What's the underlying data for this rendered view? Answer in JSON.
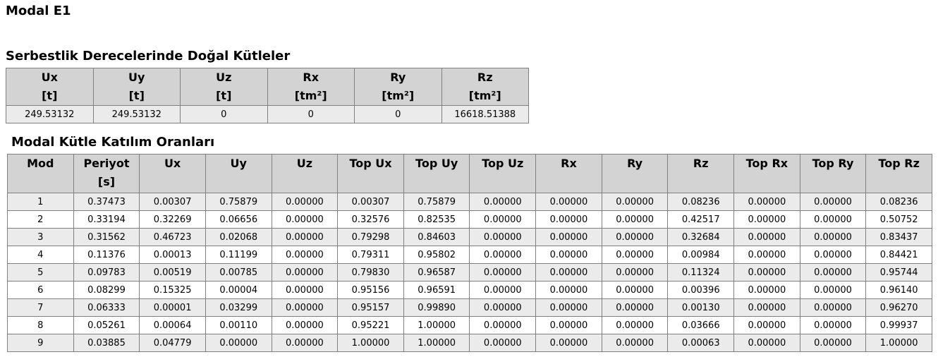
{
  "page_title": "Modal E1",
  "mass_section": {
    "title": "Serbestlik Derecelerinde Doğal Kütleler",
    "headers": [
      {
        "name": "Ux",
        "unit": "[t]"
      },
      {
        "name": "Uy",
        "unit": "[t]"
      },
      {
        "name": "Uz",
        "unit": "[t]"
      },
      {
        "name": "Rx",
        "unit": "[tm²]"
      },
      {
        "name": "Ry",
        "unit": "[tm²]"
      },
      {
        "name": "Rz",
        "unit": "[tm²]"
      }
    ],
    "row": [
      "249.53132",
      "249.53132",
      "0",
      "0",
      "0",
      "16618.51388"
    ]
  },
  "modal_section": {
    "title": "Modal Kütle Katılım Oranları",
    "headers": [
      {
        "name": "Mod",
        "unit": ""
      },
      {
        "name": "Periyot",
        "unit": "[s]"
      },
      {
        "name": "Ux",
        "unit": ""
      },
      {
        "name": "Uy",
        "unit": ""
      },
      {
        "name": "Uz",
        "unit": ""
      },
      {
        "name": "Top Ux",
        "unit": ""
      },
      {
        "name": "Top Uy",
        "unit": ""
      },
      {
        "name": "Top Uz",
        "unit": ""
      },
      {
        "name": "Rx",
        "unit": ""
      },
      {
        "name": "Ry",
        "unit": ""
      },
      {
        "name": "Rz",
        "unit": ""
      },
      {
        "name": "Top Rx",
        "unit": ""
      },
      {
        "name": "Top Ry",
        "unit": ""
      },
      {
        "name": "Top Rz",
        "unit": ""
      }
    ],
    "rows": [
      [
        "1",
        "0.37473",
        "0.00307",
        "0.75879",
        "0.00000",
        "0.00307",
        "0.75879",
        "0.00000",
        "0.00000",
        "0.00000",
        "0.08236",
        "0.00000",
        "0.00000",
        "0.08236"
      ],
      [
        "2",
        "0.33194",
        "0.32269",
        "0.06656",
        "0.00000",
        "0.32576",
        "0.82535",
        "0.00000",
        "0.00000",
        "0.00000",
        "0.42517",
        "0.00000",
        "0.00000",
        "0.50752"
      ],
      [
        "3",
        "0.31562",
        "0.46723",
        "0.02068",
        "0.00000",
        "0.79298",
        "0.84603",
        "0.00000",
        "0.00000",
        "0.00000",
        "0.32684",
        "0.00000",
        "0.00000",
        "0.83437"
      ],
      [
        "4",
        "0.11376",
        "0.00013",
        "0.11199",
        "0.00000",
        "0.79311",
        "0.95802",
        "0.00000",
        "0.00000",
        "0.00000",
        "0.00984",
        "0.00000",
        "0.00000",
        "0.84421"
      ],
      [
        "5",
        "0.09783",
        "0.00519",
        "0.00785",
        "0.00000",
        "0.79830",
        "0.96587",
        "0.00000",
        "0.00000",
        "0.00000",
        "0.11324",
        "0.00000",
        "0.00000",
        "0.95744"
      ],
      [
        "6",
        "0.08299",
        "0.15325",
        "0.00004",
        "0.00000",
        "0.95156",
        "0.96591",
        "0.00000",
        "0.00000",
        "0.00000",
        "0.00396",
        "0.00000",
        "0.00000",
        "0.96140"
      ],
      [
        "7",
        "0.06333",
        "0.00001",
        "0.03299",
        "0.00000",
        "0.95157",
        "0.99890",
        "0.00000",
        "0.00000",
        "0.00000",
        "0.00130",
        "0.00000",
        "0.00000",
        "0.96270"
      ],
      [
        "8",
        "0.05261",
        "0.00064",
        "0.00110",
        "0.00000",
        "0.95221",
        "1.00000",
        "0.00000",
        "0.00000",
        "0.00000",
        "0.03666",
        "0.00000",
        "0.00000",
        "0.99937"
      ],
      [
        "9",
        "0.03885",
        "0.04779",
        "0.00000",
        "0.00000",
        "1.00000",
        "1.00000",
        "0.00000",
        "0.00000",
        "0.00000",
        "0.00063",
        "0.00000",
        "0.00000",
        "1.00000"
      ]
    ]
  }
}
